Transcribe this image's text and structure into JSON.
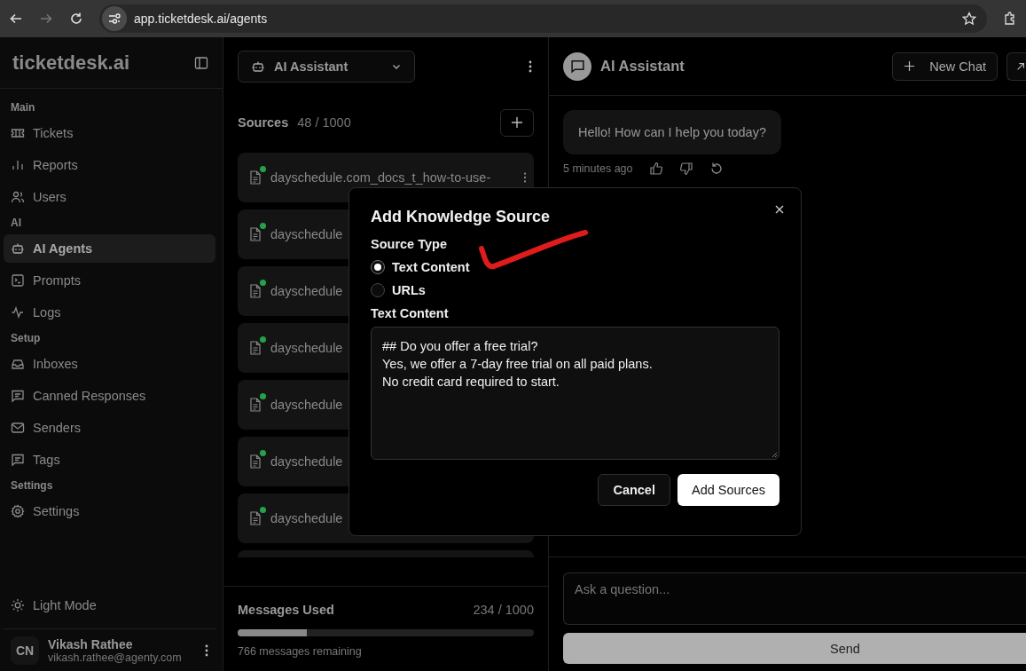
{
  "browser": {
    "url": "app.ticketdesk.ai/agents"
  },
  "sidebar": {
    "logo": "ticketdesk.ai",
    "sections": [
      {
        "title": "Main",
        "items": [
          {
            "label": "Tickets",
            "selected": false
          },
          {
            "label": "Reports",
            "selected": false
          },
          {
            "label": "Users",
            "selected": false
          }
        ]
      },
      {
        "title": "AI",
        "items": [
          {
            "label": "AI Agents",
            "selected": true
          },
          {
            "label": "Prompts",
            "selected": false
          },
          {
            "label": "Logs",
            "selected": false
          }
        ]
      },
      {
        "title": "Setup",
        "items": [
          {
            "label": "Inboxes",
            "selected": false
          },
          {
            "label": "Canned Responses",
            "selected": false
          },
          {
            "label": "Senders",
            "selected": false
          },
          {
            "label": "Tags",
            "selected": false
          }
        ]
      },
      {
        "title": "Settings",
        "items": [
          {
            "label": "Settings",
            "selected": false
          }
        ]
      }
    ],
    "theme_toggle": "Light Mode",
    "user": {
      "initials": "CN",
      "name": "Vikash Rathee",
      "email": "vikash.rathee@agenty.com"
    }
  },
  "agents": {
    "selected_agent": "AI Assistant",
    "sources": {
      "title": "Sources",
      "count": "48 / 1000",
      "items": [
        {
          "name": "dayschedule.com_docs_t_how-to-use-",
          "color": "#22a24a"
        },
        {
          "name": "dayschedule",
          "color": "#22a24a"
        },
        {
          "name": "dayschedule",
          "color": "#22a24a"
        },
        {
          "name": "dayschedule",
          "color": "#22a24a"
        },
        {
          "name": "dayschedule",
          "color": "#22a24a"
        },
        {
          "name": "dayschedule",
          "color": "#22a24a"
        },
        {
          "name": "dayschedule",
          "color": "#22a24a"
        }
      ]
    },
    "messages_used": {
      "title": "Messages Used",
      "count": "234 / 1000",
      "level": 0.234,
      "remaining": "766 messages remaining"
    }
  },
  "chat": {
    "title": "AI Assistant",
    "new_chat": "New Chat",
    "messages": [
      {
        "text": "Hello! How can I help you today?",
        "time": "5 minutes ago"
      }
    ],
    "input": {
      "placeholder": "Ask a question..."
    },
    "send": "Send"
  },
  "dialog": {
    "title": "Add Knowledge Source",
    "source_type_label": "Source Type",
    "options": [
      {
        "label": "Text Content",
        "selected": true
      },
      {
        "label": "URLs",
        "selected": false
      }
    ],
    "content_label": "Text Content",
    "content": "## Do you offer a free trial?\nYes, we offer a 7-day free trial on all paid plans.\nNo credit card required to start.",
    "cancel": "Cancel",
    "submit": "Add Sources"
  }
}
